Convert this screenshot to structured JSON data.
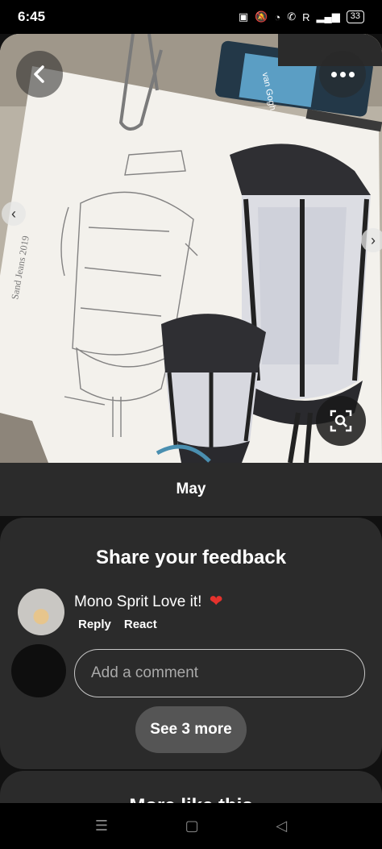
{
  "status_bar": {
    "time": "6:45",
    "network": "R",
    "battery": "33"
  },
  "pin": {
    "board_name": "May"
  },
  "feedback": {
    "title": "Share your feedback",
    "comment": {
      "text": "Mono Sprit Love it!",
      "heart": "❤",
      "reply_label": "Reply",
      "react_label": "React"
    },
    "input_placeholder": "Add a comment",
    "see_more_label": "See 3 more"
  },
  "more_like_this": {
    "title": "More like this"
  },
  "image": {
    "tube_label": "van Gogh"
  },
  "colors": {
    "background": "#111111",
    "card": "#2b2b2b",
    "heart": "#e5322d",
    "button": "#555555"
  }
}
